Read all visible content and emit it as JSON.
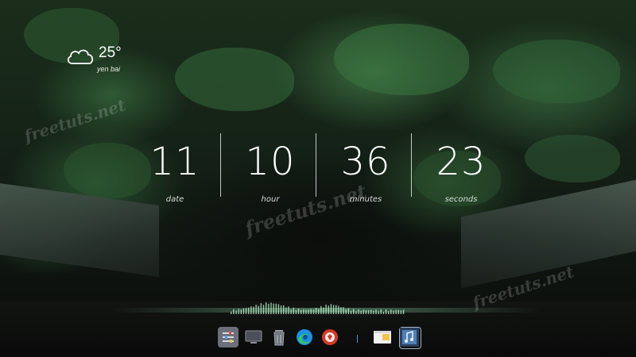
{
  "weather": {
    "temperature": "25°",
    "city": "yen bai",
    "icon": "cloud-icon"
  },
  "clock": [
    {
      "value": "11",
      "label": "date"
    },
    {
      "value": "10",
      "label": "hour"
    },
    {
      "value": "36",
      "label": "minutes"
    },
    {
      "value": "23",
      "label": "seconds"
    }
  ],
  "watermarks": [
    "freetuts.net",
    "freetuts.net",
    "freetuts.net"
  ],
  "dock": {
    "items": [
      {
        "name": "settings-sliders-icon"
      },
      {
        "name": "monitor-icon"
      },
      {
        "name": "trash-icon"
      },
      {
        "name": "edge-browser-icon"
      },
      {
        "name": "red-app-icon"
      },
      {
        "name": "file-explorer-icon"
      },
      {
        "name": "music-app-icon"
      }
    ]
  },
  "colors": {
    "text": "#ffffff",
    "dock_separator": "#5a8fd8",
    "edge_blue": "#1f8fe0",
    "edge_green": "#35c36b",
    "red_app": "#d23a2a"
  }
}
